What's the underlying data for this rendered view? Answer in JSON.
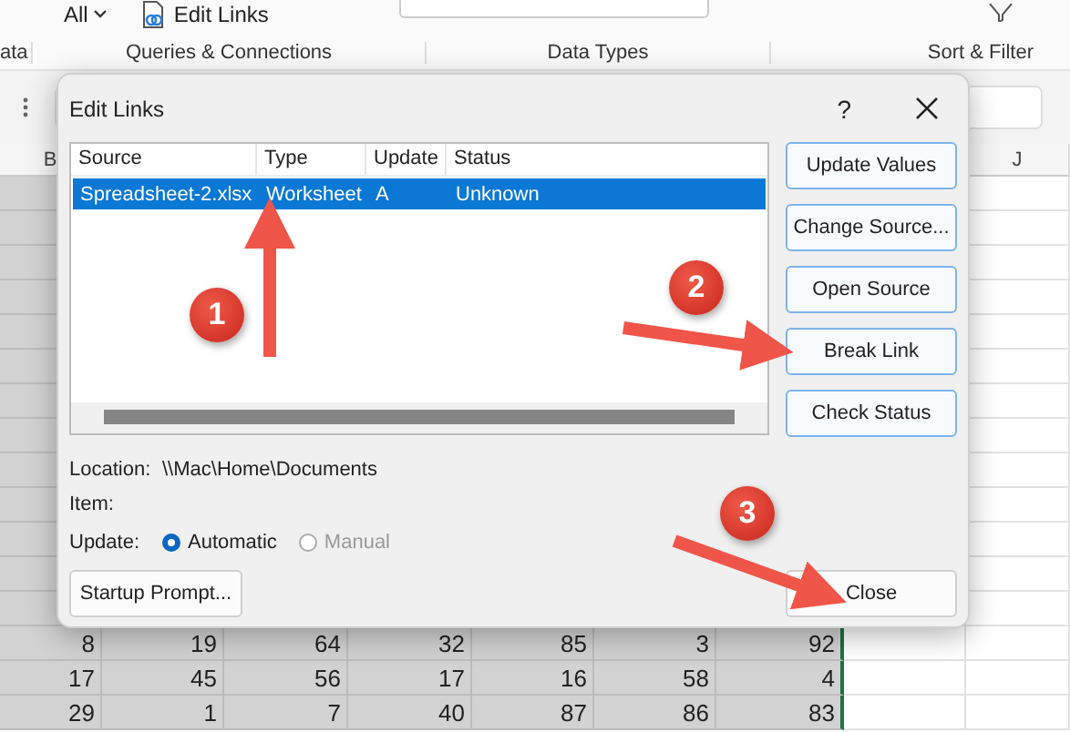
{
  "ribbon": {
    "filter_label": "All",
    "edit_links": "Edit Links",
    "groups": [
      "ata",
      "Queries & Connections",
      "Data Types",
      "Sort & Filter"
    ]
  },
  "sheet": {
    "column_headers": [
      "B",
      "J"
    ],
    "rows": [
      [
        "8",
        "19",
        "64",
        "32",
        "85",
        "3",
        "92"
      ],
      [
        "17",
        "45",
        "56",
        "17",
        "16",
        "58",
        "4"
      ],
      [
        "29",
        "1",
        "7",
        "40",
        "87",
        "86",
        "83"
      ]
    ]
  },
  "dialog": {
    "title": "Edit Links",
    "help": "?",
    "list": {
      "columns": [
        "Source",
        "Type",
        "Update",
        "Status"
      ],
      "rows": [
        {
          "cells": [
            "Spreadsheet-2.xlsx",
            "Worksheet",
            "A",
            "Unknown"
          ],
          "selected": true
        }
      ]
    },
    "side_buttons": [
      "Update Values",
      "Change Source...",
      "Open Source",
      "Break Link",
      "Check Status"
    ],
    "location": {
      "label": "Location:",
      "value": "\\\\Mac\\Home\\Documents"
    },
    "item": {
      "label": "Item:"
    },
    "update": {
      "label": "Update:",
      "options": [
        {
          "label": "Automatic",
          "selected": true,
          "disabled": false
        },
        {
          "label": "Manual",
          "selected": false,
          "disabled": true
        }
      ]
    },
    "startup_button": "Startup Prompt...",
    "close_button": "Close"
  },
  "annotations": [
    {
      "label": "1"
    },
    {
      "label": "2"
    },
    {
      "label": "3"
    }
  ]
}
